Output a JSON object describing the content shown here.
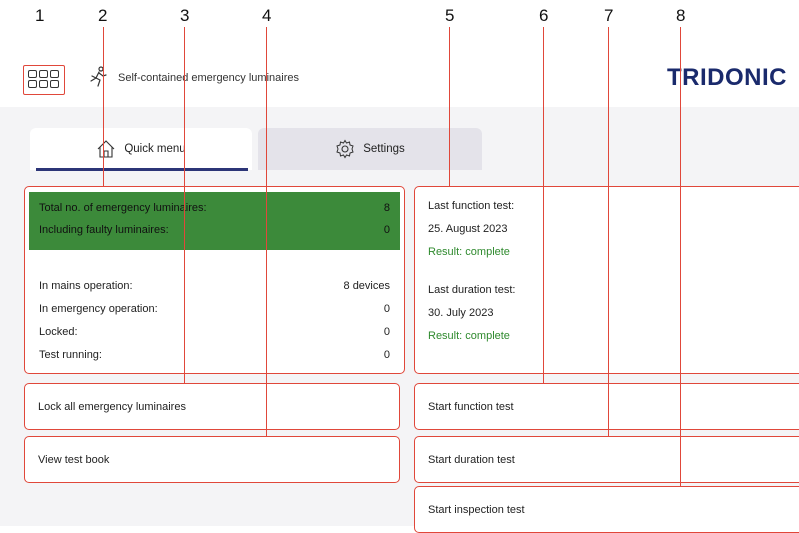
{
  "callouts": [
    "1",
    "2",
    "3",
    "4",
    "5",
    "6",
    "7",
    "8"
  ],
  "header": {
    "title": "Self-contained emergency luminaires",
    "brand": "TRIDONIC",
    "brand_color": "#1a2a6c",
    "apps_icon": "grid-apps-icon",
    "run_icon": "running-person-icon"
  },
  "tabs": [
    {
      "label": "Quick menu",
      "icon": "home-icon",
      "active": true
    },
    {
      "label": "Settings",
      "icon": "gear-icon",
      "active": false
    }
  ],
  "stats": {
    "highlight_color": "#3c8a3a",
    "highlight_rows": [
      {
        "label": "Total no. of emergency luminaires:",
        "value": "8"
      },
      {
        "label": "Including faulty luminaires:",
        "value": "0"
      }
    ],
    "rows": [
      {
        "label": "In mains operation:",
        "value": "8 devices"
      },
      {
        "label": "In emergency operation:",
        "value": "0"
      },
      {
        "label": "Locked:",
        "value": "0"
      },
      {
        "label": "Test running:",
        "value": "0"
      }
    ]
  },
  "tests": {
    "function_label": "Last function test:",
    "function_date": "25. August 2023",
    "function_result": "Result: complete",
    "duration_label": "Last duration test:",
    "duration_date": "30. July 2023",
    "duration_result": "Result: complete",
    "result_color": "#2f8a2e"
  },
  "actions": {
    "lock_all": "Lock all emergency luminaires",
    "view_test_book": "View test book",
    "start_function_test": "Start function test",
    "start_duration_test": "Start duration test",
    "start_inspection_test": "Start inspection test"
  },
  "accent_color": "#e0473a"
}
